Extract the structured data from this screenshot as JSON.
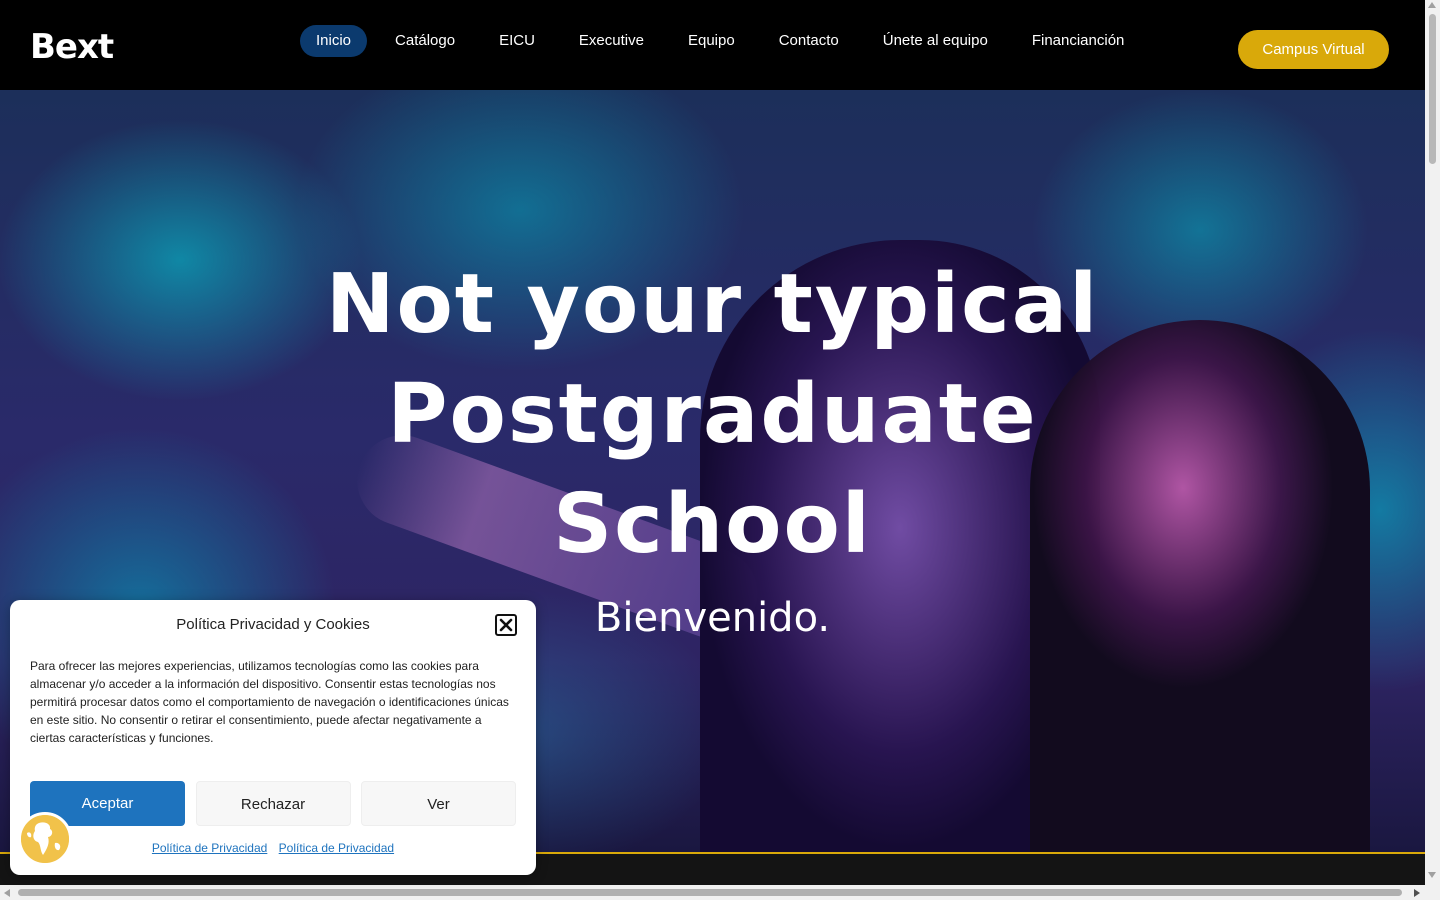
{
  "header": {
    "logo": "Bext",
    "nav": [
      {
        "label": "Inicio",
        "active": true
      },
      {
        "label": "Catálogo",
        "active": false
      },
      {
        "label": "EICU",
        "active": false
      },
      {
        "label": "Executive",
        "active": false
      },
      {
        "label": "Equipo",
        "active": false
      },
      {
        "label": "Contacto",
        "active": false
      },
      {
        "label": "Únete al equipo",
        "active": false
      },
      {
        "label": "Financianción",
        "active": false
      }
    ],
    "campus_button": "Campus Virtual"
  },
  "hero": {
    "title_line1": "Not your typical Postgraduate",
    "title_line2": "School",
    "subtitle": "Bienvenido."
  },
  "cookie": {
    "title": "Política Privacidad y Cookies",
    "text": "Para ofrecer las mejores experiencias, utilizamos tecnologías como las cookies para almacenar y/o acceder a la información del dispositivo. Consentir estas tecnologías nos permitirá procesar datos como el comportamiento de navegación o identificaciones únicas en este sitio. No consentir o retirar el consentimiento, puede afectar negativamente a ciertas características y funciones.",
    "accept": "Aceptar",
    "reject": "Rechazar",
    "view": "Ver",
    "links": [
      "Política de Privacidad",
      "Política de Privacidad"
    ]
  },
  "colors": {
    "header_bg": "#000000",
    "active_nav": "#0b3a6e",
    "campus_btn": "#d9a90a",
    "accept_btn": "#1e73be"
  },
  "icons": {
    "close": "close-icon",
    "globe": "globe-icon"
  }
}
